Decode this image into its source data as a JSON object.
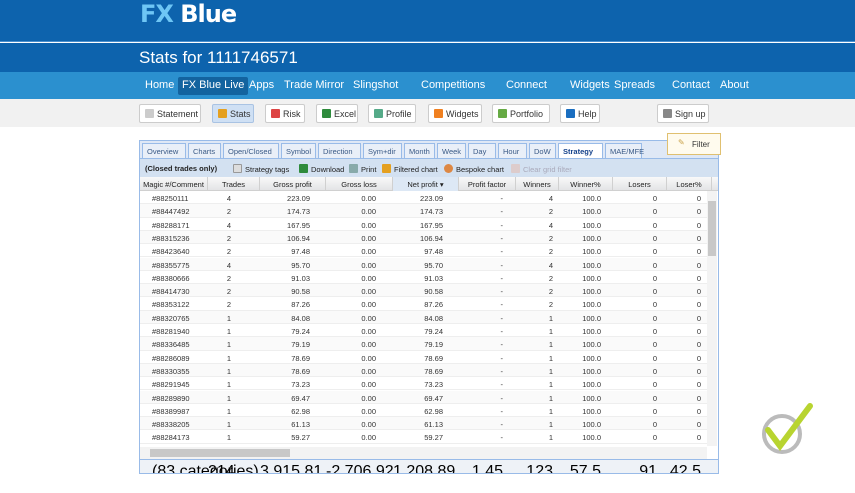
{
  "header": {
    "logo_fx": "FX",
    "logo_blue": " Blue",
    "title": "Stats for 1111746571"
  },
  "nav": [
    "Home",
    "FX Blue Live",
    "Apps",
    "Trade Mirror",
    "Slingshot",
    "Competitions",
    "Connect",
    "Widgets",
    "Spreads",
    "Contact",
    "About"
  ],
  "toolbar": [
    "Statement",
    "Stats",
    "Risk",
    "Excel",
    "Profile",
    "Widgets",
    "Portfolio",
    "Help"
  ],
  "signup": "Sign up",
  "filter": "Filter",
  "tabs": [
    "Overview",
    "Charts",
    "Open/Closed",
    "Symbol",
    "Direction",
    "Sym+dir",
    "Month",
    "Week",
    "Day",
    "Hour",
    "DoW",
    "Strategy",
    "MAE/MFE"
  ],
  "grid_toolbar": {
    "note": "(Closed trades only)",
    "strategy_tags": "Strategy tags",
    "download": "Download",
    "print": "Print",
    "filtered_chart": "Filtered chart",
    "bespoke_chart": "Bespoke chart",
    "clear_filter": "Clear grid filter"
  },
  "columns": [
    "Magic #/Comment",
    "Trades",
    "Gross profit",
    "Gross loss",
    "Net profit ▾",
    "Profit factor",
    "Winners",
    "Winner%",
    "Losers",
    "Loser%"
  ],
  "rows": [
    [
      "#88250111",
      "4",
      "223.09",
      "0.00",
      "223.09",
      "-",
      "4",
      "100.0",
      "0",
      "0"
    ],
    [
      "#88447492",
      "2",
      "174.73",
      "0.00",
      "174.73",
      "-",
      "2",
      "100.0",
      "0",
      "0"
    ],
    [
      "#88288171",
      "4",
      "167.95",
      "0.00",
      "167.95",
      "-",
      "4",
      "100.0",
      "0",
      "0"
    ],
    [
      "#88315236",
      "2",
      "106.94",
      "0.00",
      "106.94",
      "-",
      "2",
      "100.0",
      "0",
      "0"
    ],
    [
      "#88423640",
      "2",
      "97.48",
      "0.00",
      "97.48",
      "-",
      "2",
      "100.0",
      "0",
      "0"
    ],
    [
      "#88355775",
      "4",
      "95.70",
      "0.00",
      "95.70",
      "-",
      "4",
      "100.0",
      "0",
      "0"
    ],
    [
      "#88380666",
      "2",
      "91.03",
      "0.00",
      "91.03",
      "-",
      "2",
      "100.0",
      "0",
      "0"
    ],
    [
      "#88414730",
      "2",
      "90.58",
      "0.00",
      "90.58",
      "-",
      "2",
      "100.0",
      "0",
      "0"
    ],
    [
      "#88353122",
      "2",
      "87.26",
      "0.00",
      "87.26",
      "-",
      "2",
      "100.0",
      "0",
      "0"
    ],
    [
      "#88320765",
      "1",
      "84.08",
      "0.00",
      "84.08",
      "-",
      "1",
      "100.0",
      "0",
      "0"
    ],
    [
      "#88281940",
      "1",
      "79.24",
      "0.00",
      "79.24",
      "-",
      "1",
      "100.0",
      "0",
      "0"
    ],
    [
      "#88336485",
      "1",
      "79.19",
      "0.00",
      "79.19",
      "-",
      "1",
      "100.0",
      "0",
      "0"
    ],
    [
      "#88286089",
      "1",
      "78.69",
      "0.00",
      "78.69",
      "-",
      "1",
      "100.0",
      "0",
      "0"
    ],
    [
      "#88330355",
      "1",
      "78.69",
      "0.00",
      "78.69",
      "-",
      "1",
      "100.0",
      "0",
      "0"
    ],
    [
      "#88291945",
      "1",
      "73.23",
      "0.00",
      "73.23",
      "-",
      "1",
      "100.0",
      "0",
      "0"
    ],
    [
      "#88289890",
      "1",
      "69.47",
      "0.00",
      "69.47",
      "-",
      "1",
      "100.0",
      "0",
      "0"
    ],
    [
      "#88389987",
      "1",
      "62.98",
      "0.00",
      "62.98",
      "-",
      "1",
      "100.0",
      "0",
      "0"
    ],
    [
      "#88338205",
      "1",
      "61.13",
      "0.00",
      "61.13",
      "-",
      "1",
      "100.0",
      "0",
      "0"
    ],
    [
      "#88284173",
      "1",
      "59.27",
      "0.00",
      "59.27",
      "-",
      "1",
      "100.0",
      "0",
      "0"
    ]
  ],
  "footer": [
    "(83 categories)",
    "214",
    "3,915.81",
    "-2,706.92",
    "1,208.89",
    "1.45",
    "123",
    "57.5",
    "91",
    "42.5"
  ]
}
